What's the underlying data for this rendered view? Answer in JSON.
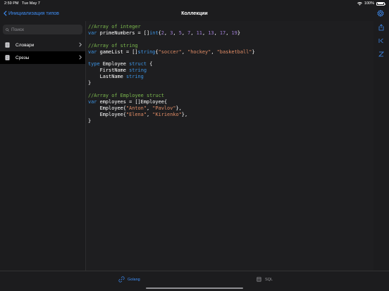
{
  "status_bar": {
    "time": "2:59 PM",
    "date": "Tue May 7",
    "battery": "100%"
  },
  "nav": {
    "back_label": "Инициализация типов",
    "title": "Коллекции"
  },
  "sidebar": {
    "search_placeholder": "Поиск",
    "items": [
      {
        "label": "Словари",
        "selected": false
      },
      {
        "label": "Срезы",
        "selected": true
      }
    ]
  },
  "editor": {
    "code": [
      "//Array of integer",
      "var primeNumbers = []int{2, 3, 5, 7, 11, 13, 17, 19}",
      "",
      "//Array of string",
      "var gameList = []string{\"soccer\", \"hockey\", \"basketball\"}",
      "",
      "type Employee struct {",
      "    FirstName string",
      "    LastName string",
      "}",
      "",
      "//Array of Employee struct",
      "var employees = []Employee{",
      "    Employee{\"Anton\", \"Pavlov\"},",
      "    Employee{\"Elena\", \"Kirienko\"},",
      "}"
    ]
  },
  "tabs": [
    {
      "label": "Golang",
      "active": true
    },
    {
      "label": "SQL",
      "active": false
    }
  ],
  "colors": {
    "accent": "#3e8ef7",
    "comment": "#7dbb4e",
    "keyword": "#3c95e6",
    "string": "#e28d66",
    "number": "#a07ed6"
  }
}
